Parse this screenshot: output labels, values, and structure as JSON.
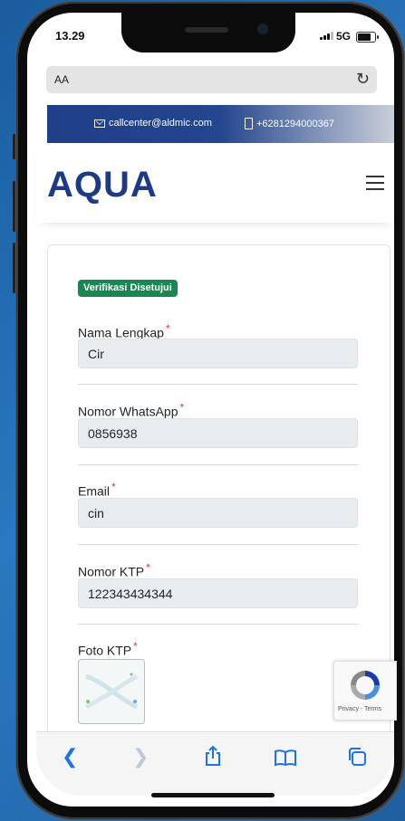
{
  "status": {
    "time": "13.29",
    "network": "5G"
  },
  "browser": {
    "aa_label": "AA",
    "reload_icon": "reload-icon"
  },
  "topbar": {
    "email": "callcenter@aldmic.com",
    "phone": "+6281294000367"
  },
  "header": {
    "logo_text": "AQUA",
    "menu_icon": "hamburger-menu-icon"
  },
  "form": {
    "badge": "Verifikasi Disetujui",
    "fields": [
      {
        "label": "Nama Lengkap",
        "value": "Cir"
      },
      {
        "label": "Nomor WhatsApp",
        "value": "0856938"
      },
      {
        "label": "Email",
        "value": "cin"
      },
      {
        "label": "Nomor KTP",
        "value": "122343434344"
      }
    ],
    "photo_label": "Foto KTP",
    "required_mark": "*"
  },
  "recaptcha": {
    "text": "Privacy - Terms"
  },
  "colors": {
    "brand": "#1c3a86",
    "badge": "#198754",
    "required": "#dc3545",
    "safari_blue": "#1a73e8"
  }
}
